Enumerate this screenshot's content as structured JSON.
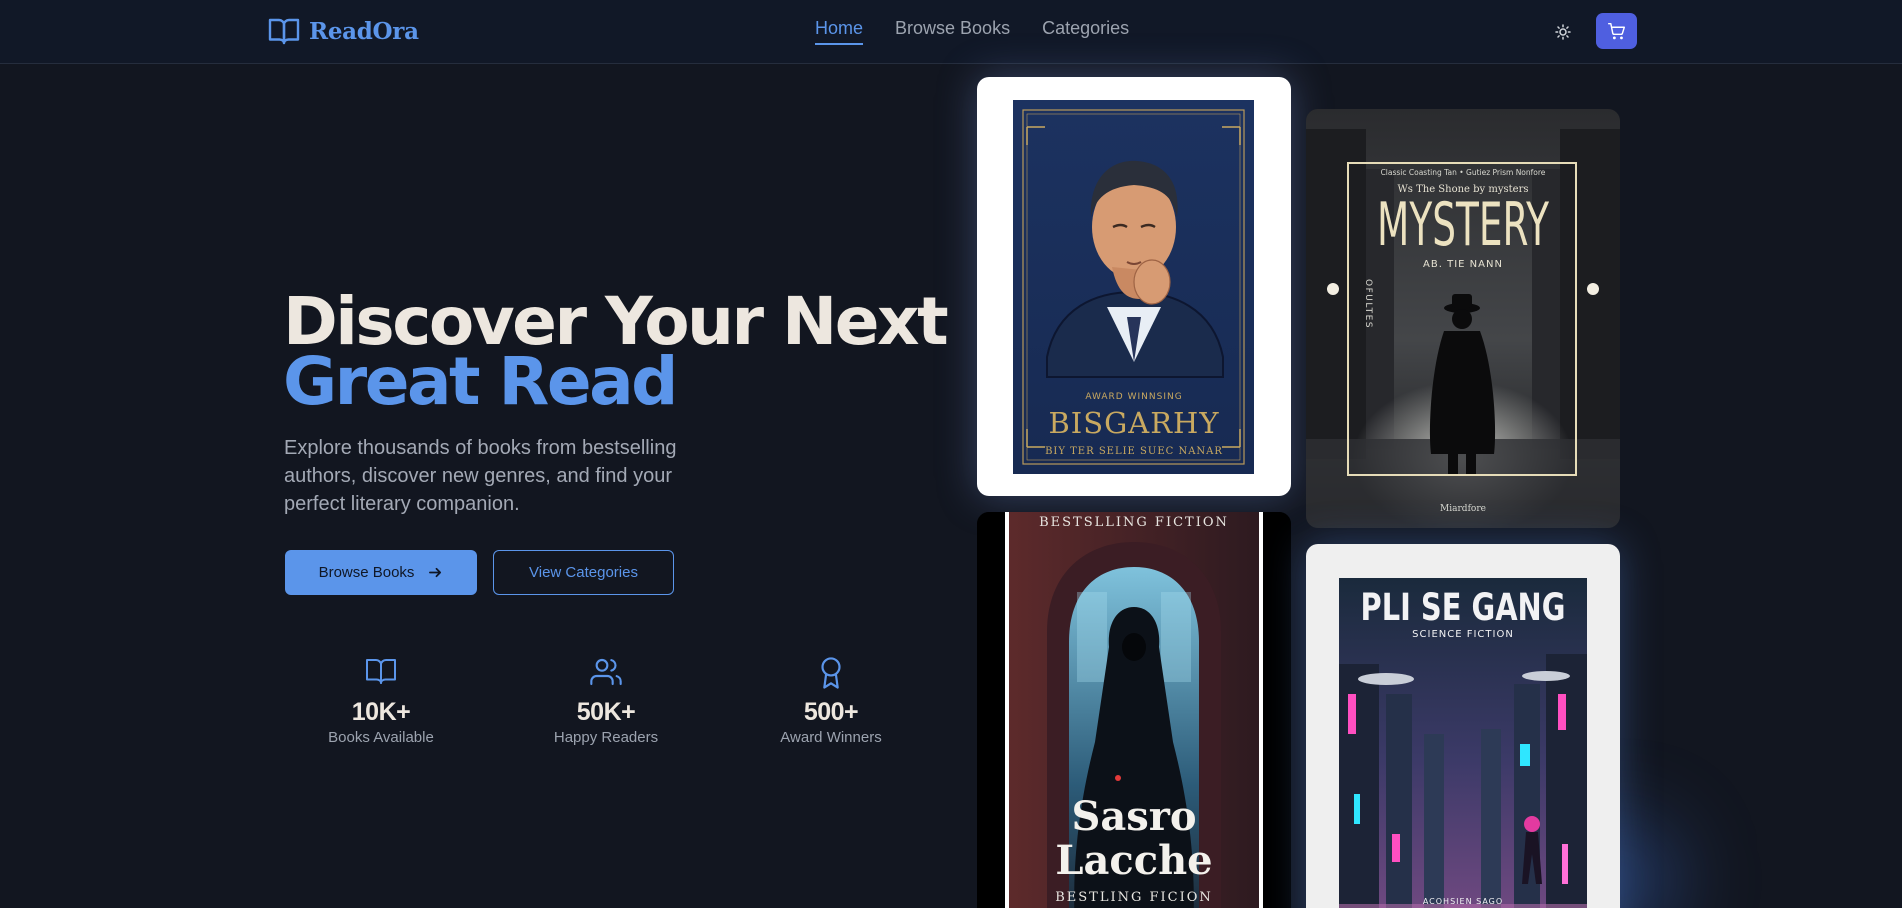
{
  "header": {
    "brand_name": "ReadOra",
    "nav": [
      {
        "label": "Home",
        "active": true
      },
      {
        "label": "Browse Books",
        "active": false
      },
      {
        "label": "Categories",
        "active": false
      }
    ],
    "theme_icon": "sun-icon",
    "cart_icon": "cart-icon"
  },
  "hero": {
    "title_line1": "Discover Your Next",
    "title_line2": "Great Read",
    "subtitle": "Explore thousands of books from bestselling authors, discover new genres, and find your perfect literary companion.",
    "primary_button": "Browse Books",
    "secondary_button": "View Categories"
  },
  "stats": [
    {
      "value": "10K+",
      "label": "Books Available",
      "icon": "book-icon"
    },
    {
      "value": "50K+",
      "label": "Happy Readers",
      "icon": "users-icon"
    },
    {
      "value": "500+",
      "label": "Award Winners",
      "icon": "award-icon"
    }
  ],
  "books": [
    {
      "top_text": "AWARD WINNSING",
      "title": "BISGARHY",
      "subtitle": "BIY TER SELIE SUEC NANAR"
    },
    {
      "top_text": "Classic Coasting Tan • Gutiez Prism Nonfore",
      "tagline": "Ws The Shone by mysters",
      "title": "MYSTERY",
      "author": "AB. TIE NANN",
      "side_text": "OFULTES",
      "footer": "Miardfore"
    },
    {
      "top_text": "BESTSLLING FICTION",
      "title_line1": "Sasro",
      "title_line2": "Lacche",
      "footer": "BESTLING FICION"
    },
    {
      "title": "PLI SE GANG",
      "subtitle": "SCIENCE FICTION",
      "footer": "ACOHSIEN SAGO"
    }
  ],
  "colors": {
    "accent": "#5b95ea",
    "background": "#121620",
    "navbar": "#111827",
    "cart_button": "#4f5fe0"
  }
}
